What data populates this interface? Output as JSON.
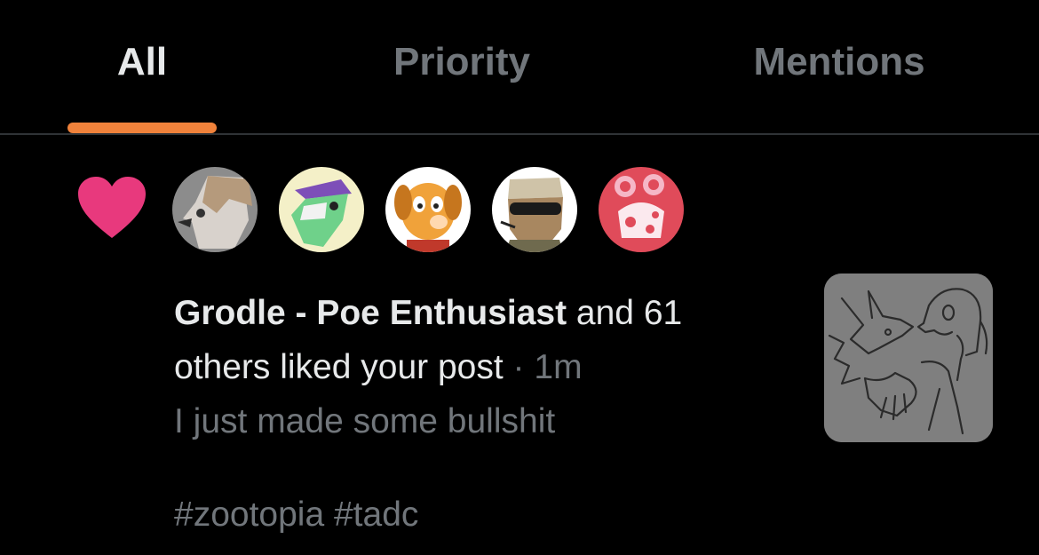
{
  "tabs": {
    "all": "All",
    "priority": "Priority",
    "mentions": "Mentions",
    "active": "All"
  },
  "colors": {
    "accent": "#f0823b",
    "like": "#e8397d",
    "muted": "#71767b",
    "text": "#e7e9ea"
  },
  "notification": {
    "type_icon": "heart-icon",
    "actor_name": "Grodle - Poe Enthusiast",
    "summary_rest": " and 61",
    "summary_line2": "others liked your post",
    "separator": " · ",
    "time": "1m",
    "post_text": "I just made some bullshit",
    "post_tags": "#zootopia #tadc",
    "avatar_count": 5
  }
}
